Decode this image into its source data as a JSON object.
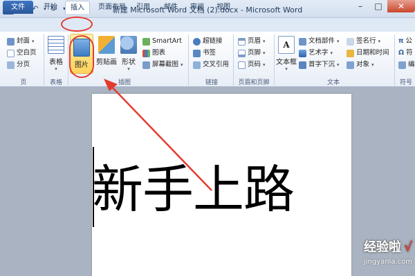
{
  "window": {
    "title": "新建 Microsoft Word 文档 (2).docx - Microsoft Word",
    "app_icon": "W",
    "controls": {
      "minimize": "–",
      "maximize": "□",
      "close": "✕"
    }
  },
  "quick_access": {
    "save_icon": "save-icon",
    "undo_icon": "undo-icon",
    "redo_icon": "redo-icon"
  },
  "tabs": [
    {
      "label": "文件"
    },
    {
      "label": "开始"
    },
    {
      "label": "插入"
    },
    {
      "label": "页面布局"
    },
    {
      "label": "引用"
    },
    {
      "label": "邮件"
    },
    {
      "label": "审阅"
    },
    {
      "label": "视图"
    }
  ],
  "ribbon": {
    "pages": {
      "cover": "封面",
      "blank": "空白页",
      "break": "分页",
      "label": "页"
    },
    "tables": {
      "table": "表格",
      "label": "表格"
    },
    "illustrations": {
      "picture": "图片",
      "clipart": "剪贴画",
      "shapes": "形状",
      "smartart": "SmartArt",
      "chart": "图表",
      "screenshot": "屏幕截图",
      "label": "插图"
    },
    "links": {
      "hyperlink": "超链接",
      "bookmark": "书签",
      "crossref": "交叉引用",
      "label": "链接"
    },
    "header_footer": {
      "header": "页眉",
      "footer": "页脚",
      "page_number": "页码",
      "label": "页眉和页脚"
    },
    "text": {
      "textbox": "文本框",
      "quickparts": "文档部件",
      "wordart": "艺术字",
      "dropcap": "首字下沉",
      "signature": "签名行",
      "datetime": "日期和时间",
      "object": "对象",
      "label": "文本"
    },
    "symbols": {
      "equation": "公",
      "symbol": "符",
      "number": "编",
      "label": "符号"
    }
  },
  "document": {
    "text": "新手上路"
  },
  "watermark": {
    "title": "经验啦",
    "check": "√",
    "url": "jingyanla.com"
  },
  "colors": {
    "annotation_red": "#e53a2f",
    "file_tab_blue": "#2b579a",
    "page_bg": "#a9b3c2"
  }
}
